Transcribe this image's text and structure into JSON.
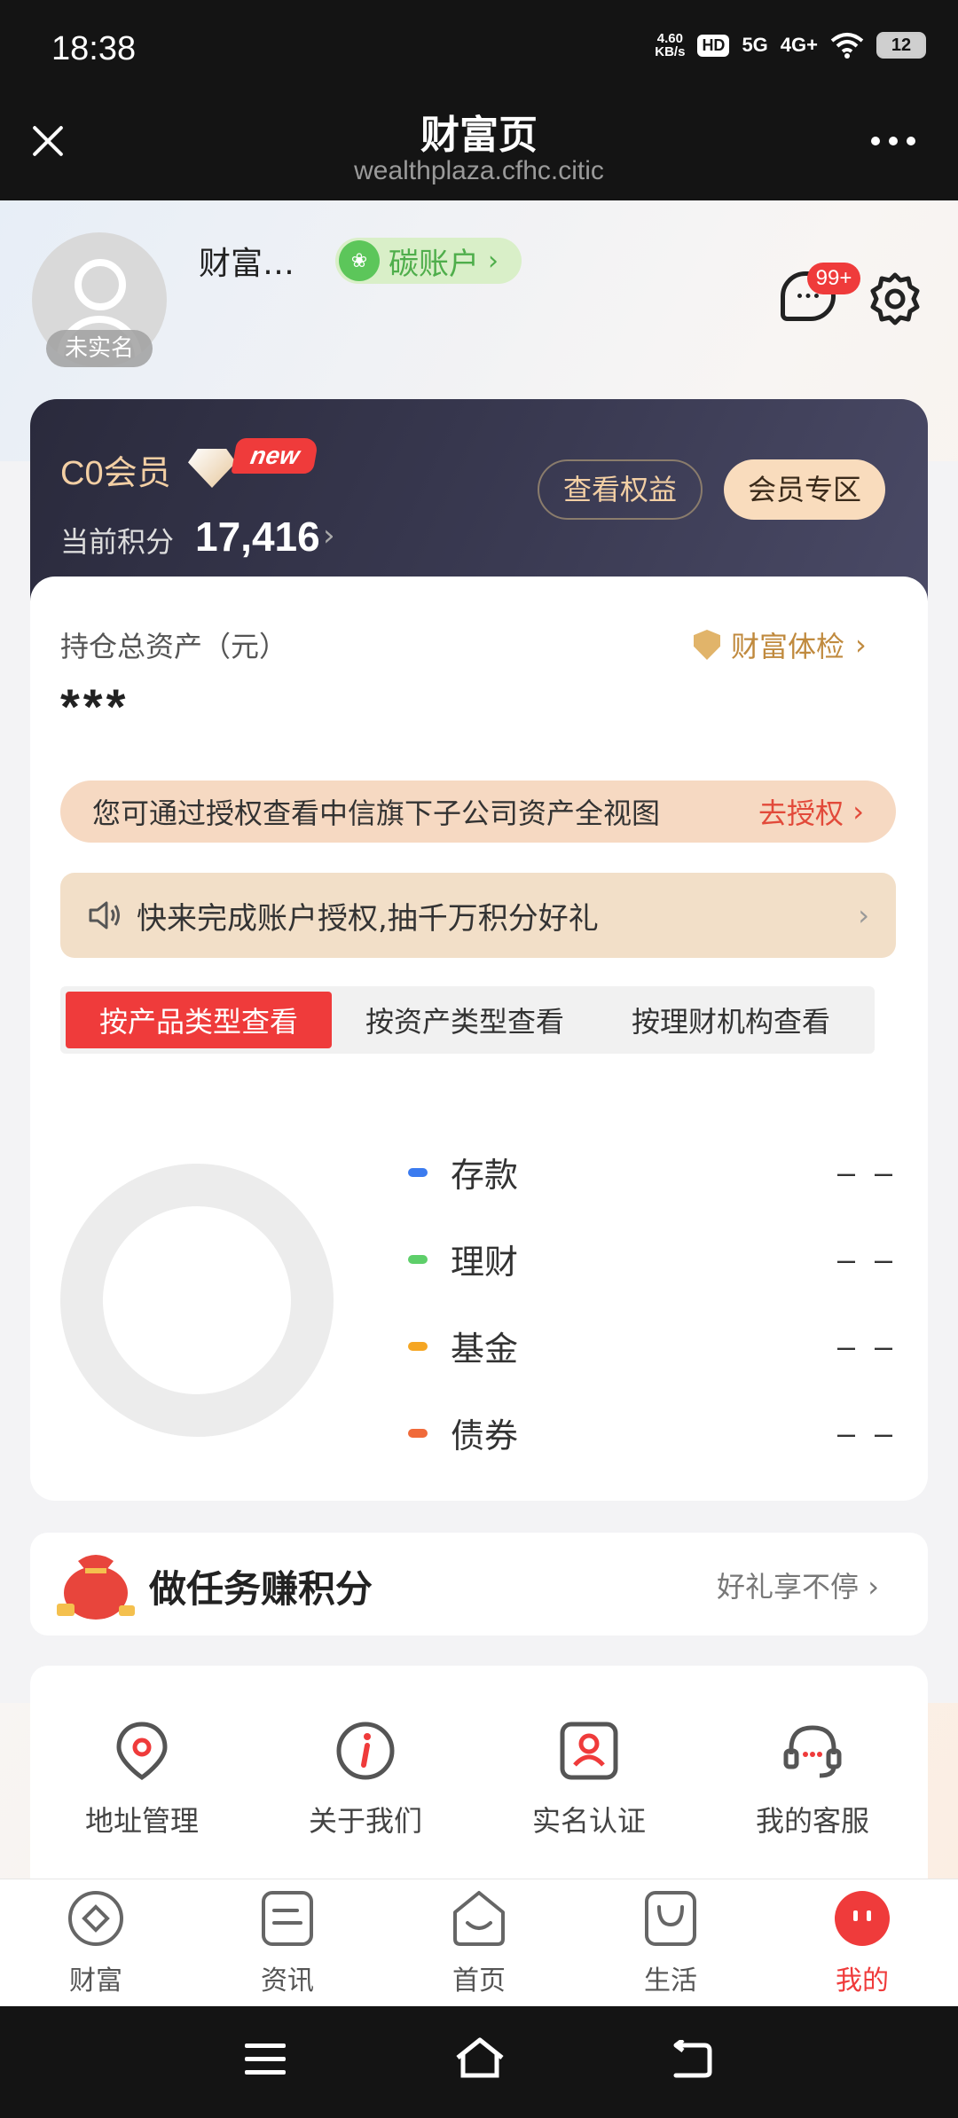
{
  "status": {
    "time": "18:38",
    "net_speed_value": "4.60",
    "net_speed_unit": "KB/s",
    "hd_label": "HD",
    "signal_1": "5G",
    "signal_2": "4G+",
    "battery": "12"
  },
  "titlebar": {
    "title": "财富页",
    "url": "wealthplaza.cfhc.citic"
  },
  "profile": {
    "username": "财富…",
    "avatar_badge": "未实名",
    "carbon_account": "碳账户",
    "message_badge": "99+"
  },
  "member": {
    "level": "C0会员",
    "new_badge": "new",
    "points_label": "当前积分",
    "points_value": "17,416",
    "rights_button": "查看权益",
    "zone_button": "会员专区"
  },
  "assets": {
    "title": "持仓总资产（元）",
    "value": "***",
    "health_check": "财富体检",
    "auth_text": "您可通过授权查看中信旗下子公司资产全视图",
    "auth_link": "去授权",
    "promo_text": "快来完成账户授权,抽千万积分好礼",
    "tabs": [
      {
        "label": "按产品类型查看",
        "active": true
      },
      {
        "label": "按资产类型查看",
        "active": false
      },
      {
        "label": "按理财机构查看",
        "active": false
      }
    ],
    "legend": [
      {
        "name": "存款",
        "value": "– –",
        "color": "#3b7bef"
      },
      {
        "name": "理财",
        "value": "– –",
        "color": "#5ecf6a"
      },
      {
        "name": "基金",
        "value": "– –",
        "color": "#f5a623"
      },
      {
        "name": "债券",
        "value": "– –",
        "color": "#f06a3a"
      }
    ]
  },
  "task": {
    "title": "做任务赚积分",
    "subtitle": "好礼享不停"
  },
  "services": [
    {
      "label": "地址管理",
      "icon": "location-pin-icon"
    },
    {
      "label": "关于我们",
      "icon": "info-icon"
    },
    {
      "label": "实名认证",
      "icon": "id-card-icon"
    },
    {
      "label": "我的客服",
      "icon": "headset-icon"
    }
  ],
  "bottom_nav": [
    {
      "label": "财富",
      "icon": "wealth-icon",
      "active": false
    },
    {
      "label": "资讯",
      "icon": "news-icon",
      "active": false
    },
    {
      "label": "首页",
      "icon": "home-icon",
      "active": false
    },
    {
      "label": "生活",
      "icon": "life-bag-icon",
      "active": false
    },
    {
      "label": "我的",
      "icon": "mine-icon",
      "active": true
    }
  ],
  "colors": {
    "accent_red": "#ef3b3b",
    "gold": "#c08a3e",
    "card_dark": "#2a2a3c"
  }
}
